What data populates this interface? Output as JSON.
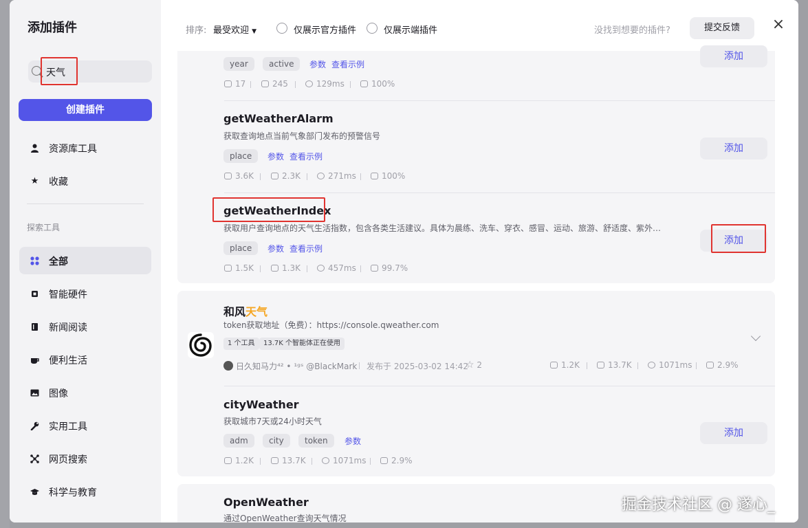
{
  "sidebar": {
    "title": "添加插件",
    "search_value": "天气",
    "create_button": "创建插件",
    "top_items": [
      {
        "label": "资源库工具",
        "icon": "person-icon"
      },
      {
        "label": "收藏",
        "icon": "star-icon"
      }
    ],
    "section_label": "探索工具",
    "categories": [
      {
        "label": "全部",
        "icon": "grid-icon",
        "active": true
      },
      {
        "label": "智能硬件",
        "icon": "chip-icon"
      },
      {
        "label": "新闻阅读",
        "icon": "book-icon"
      },
      {
        "label": "便利生活",
        "icon": "cup-icon"
      },
      {
        "label": "图像",
        "icon": "image-icon"
      },
      {
        "label": "实用工具",
        "icon": "wrench-icon"
      },
      {
        "label": "网页搜索",
        "icon": "network-icon"
      },
      {
        "label": "科学与教育",
        "icon": "graduation-cap-icon"
      }
    ]
  },
  "topbar": {
    "sort_label": "排序:",
    "sort_value": "最受欢迎",
    "filter_official": "仅展示官方插件",
    "filter_device": "仅展示端插件",
    "feedback_question": "没找到想要的插件?",
    "feedback_button": "提交反馈"
  },
  "card1": {
    "rows": [
      {
        "tags": [
          "year",
          "active"
        ],
        "links": [
          "参数",
          "查看示例"
        ],
        "stats": [
          "17",
          "245",
          "129ms",
          "100%"
        ],
        "add_label": "添加"
      },
      {
        "name": "getWeatherAlarm",
        "desc": "获取查询地点当前气象部门发布的预警信号",
        "tags": [
          "place"
        ],
        "links": [
          "参数",
          "查看示例"
        ],
        "stats": [
          "3.6K",
          "2.3K",
          "271ms",
          "100%"
        ],
        "add_label": "添加"
      },
      {
        "name": "getWeatherIndex",
        "desc": "获取用户查询地点的天气生活指数，包含各类生活建议。具体为晨练、洗车、穿衣、感冒、运动、旅游、舒适度、紫外…",
        "tags": [
          "place"
        ],
        "links": [
          "参数",
          "查看示例"
        ],
        "stats": [
          "1.5K",
          "1.3K",
          "457ms",
          "99.7%"
        ],
        "add_label": "添加"
      }
    ]
  },
  "plugin": {
    "name_prefix": "和风",
    "name_highlight": "天气",
    "desc": "token获取地址（免费）：https://console.qweather.com",
    "badges": [
      "1 个工具",
      "13.7K 个智能体正在使用"
    ],
    "author": "日久知马力⁴² • ¹ᵍˢ @BlackMark",
    "published": "发布于 2025-03-02 14:42",
    "stars": "2",
    "stats": [
      "1.2K",
      "13.7K",
      "1071ms",
      "2.9%"
    ],
    "highlight_color": "#f5a623"
  },
  "card2": {
    "row": {
      "name": "cityWeather",
      "desc": "获取城市7天或24小时天气",
      "tags": [
        "adm",
        "city",
        "token"
      ],
      "links": [
        "参数"
      ],
      "stats": [
        "1.2K",
        "13.7K",
        "1071ms",
        "2.9%"
      ],
      "add_label": "添加"
    }
  },
  "card3": {
    "name": "OpenWeather",
    "desc": "通过OpenWeather查询天气情况"
  },
  "watermark": "掘金技术社区 @ 遂心_"
}
